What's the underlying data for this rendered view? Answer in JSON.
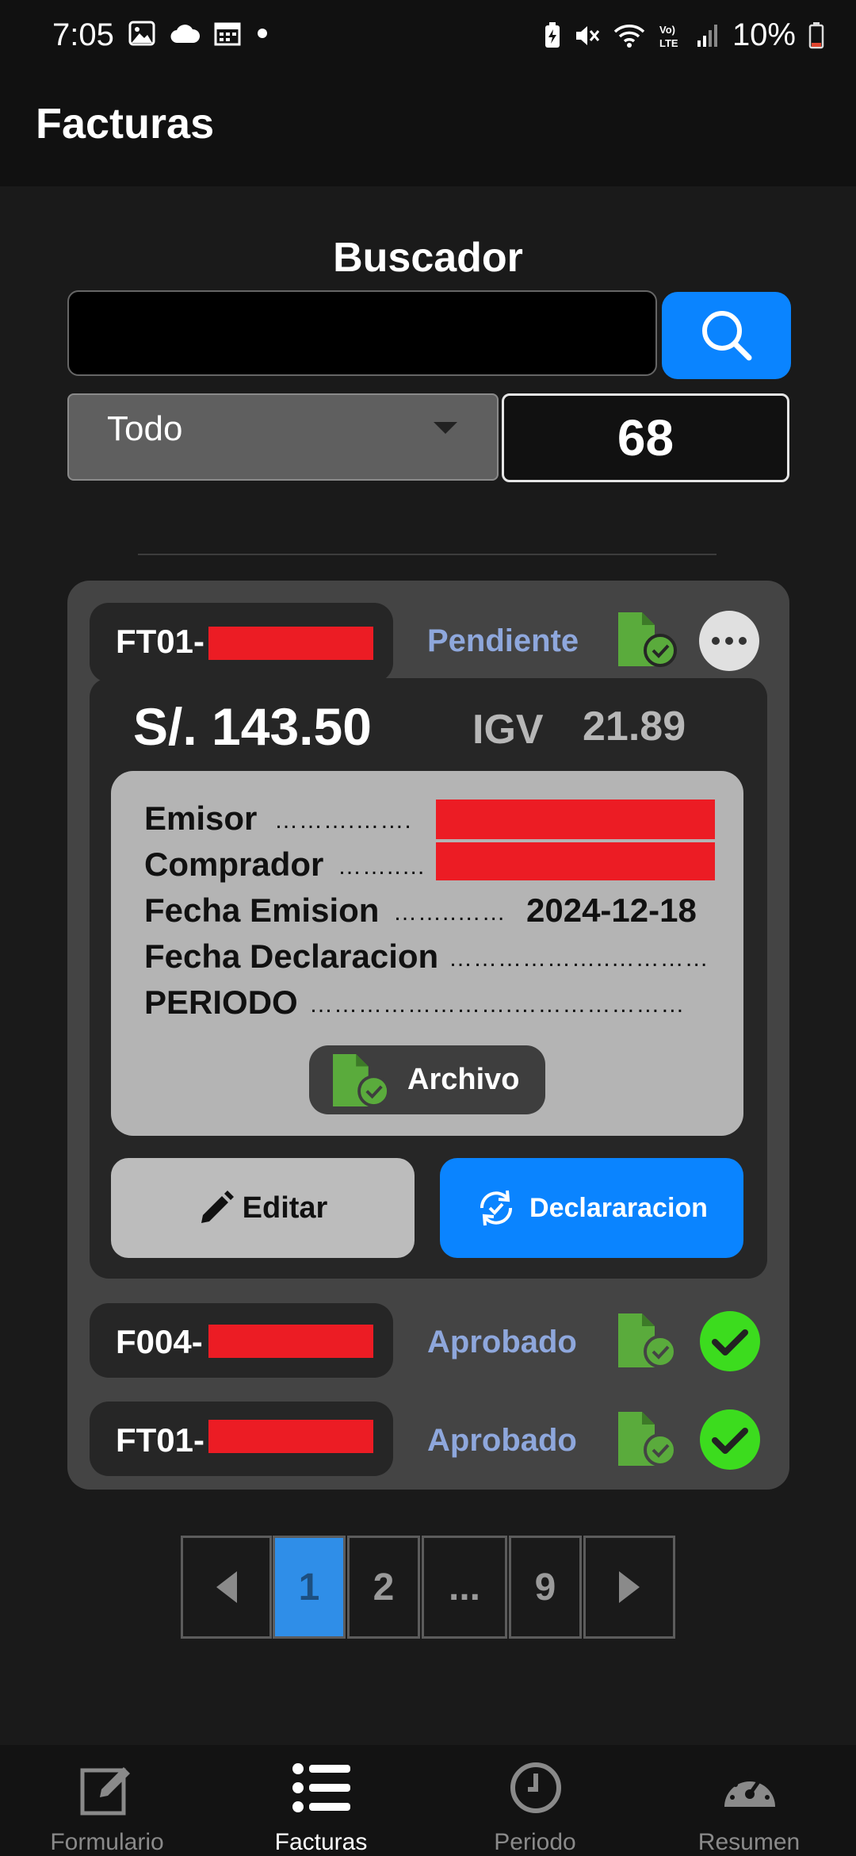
{
  "status_bar": {
    "time": "7:05",
    "battery": "10%",
    "icons_left": [
      "image-icon",
      "cloud-icon",
      "calendar-icon",
      "dot-icon"
    ],
    "icons_right": [
      "battery-saver-icon",
      "mute-icon",
      "wifi-icon",
      "volte-icon",
      "signal-icon",
      "battery-icon"
    ]
  },
  "app_bar": {
    "title": "Facturas"
  },
  "search": {
    "title": "Buscador",
    "input_value": "",
    "filter_selected": "Todo",
    "count": "68"
  },
  "invoices": [
    {
      "code": "FT01-",
      "status": "Pendiente",
      "expanded": true,
      "amount": "S/. 143.50",
      "igv_label": "IGV",
      "igv_value": "21.89",
      "fields": {
        "emisor_label": "Emisor",
        "emisor_dots": "……….…….",
        "comprador_label": "Comprador",
        "comprador_dots": "……..…",
        "fecha_emision_label": "Fecha Emision",
        "fecha_emision_dots": "……..……",
        "fecha_emision_value": "2024-12-18",
        "fecha_declaracion_label": "Fecha Declaracion",
        "fecha_declaracion_dots": "………………..…………",
        "periodo_label": "PERIODO",
        "periodo_dots": "…………………….…………………"
      },
      "archivo_label": "Archivo",
      "edit_label": "Editar",
      "declaration_label": "Declararacion"
    },
    {
      "code": "F004-",
      "status": "Aprobado",
      "expanded": false
    },
    {
      "code": "FT01-",
      "status": "Aprobado",
      "expanded": false
    }
  ],
  "pagination": {
    "pages": [
      "1",
      "2",
      "...",
      "9"
    ],
    "current": "1"
  },
  "bottom_nav": [
    {
      "label": "Formulario",
      "icon": "edit-form-icon",
      "active": false
    },
    {
      "label": "Facturas",
      "icon": "list-icon",
      "active": true
    },
    {
      "label": "Periodo",
      "icon": "clock-icon",
      "active": false
    },
    {
      "label": "Resumen",
      "icon": "gauge-icon",
      "active": false
    }
  ],
  "colors": {
    "accent_blue": "#0a84ff",
    "status_label": "#8ea7dc",
    "approved_green": "#3cdc1e",
    "file_icon_green": "#5aab3c",
    "redaction_red": "#ec1c24"
  }
}
